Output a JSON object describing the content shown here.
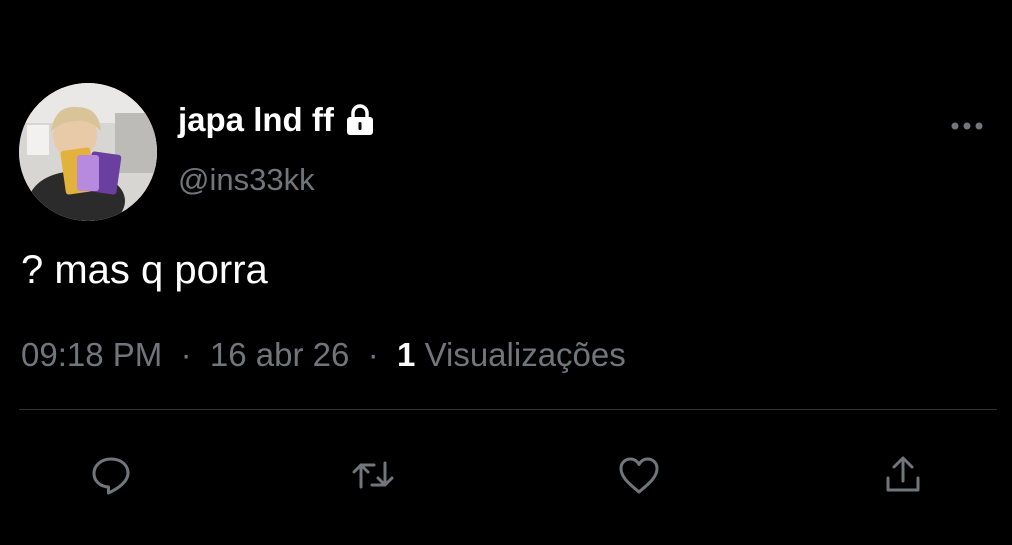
{
  "user": {
    "display_name": "japa lnd ff",
    "handle": "@ins33kk",
    "avatar": "profile-photo",
    "protected_icon": "lock-icon"
  },
  "tweet": {
    "text": "? mas q porra",
    "time": "09:18 PM",
    "separator": "·",
    "date": "16 abr 26",
    "views_count": "1",
    "views_label": "Visualizações"
  },
  "actions": {
    "more": "more-icon",
    "reply": "reply-icon",
    "retweet": "retweet-icon",
    "like": "like-icon",
    "share": "share-icon"
  },
  "colors": {
    "background": "#000000",
    "primary_text": "#ffffff",
    "secondary_text": "#71767b",
    "divider": "#2f3336"
  }
}
